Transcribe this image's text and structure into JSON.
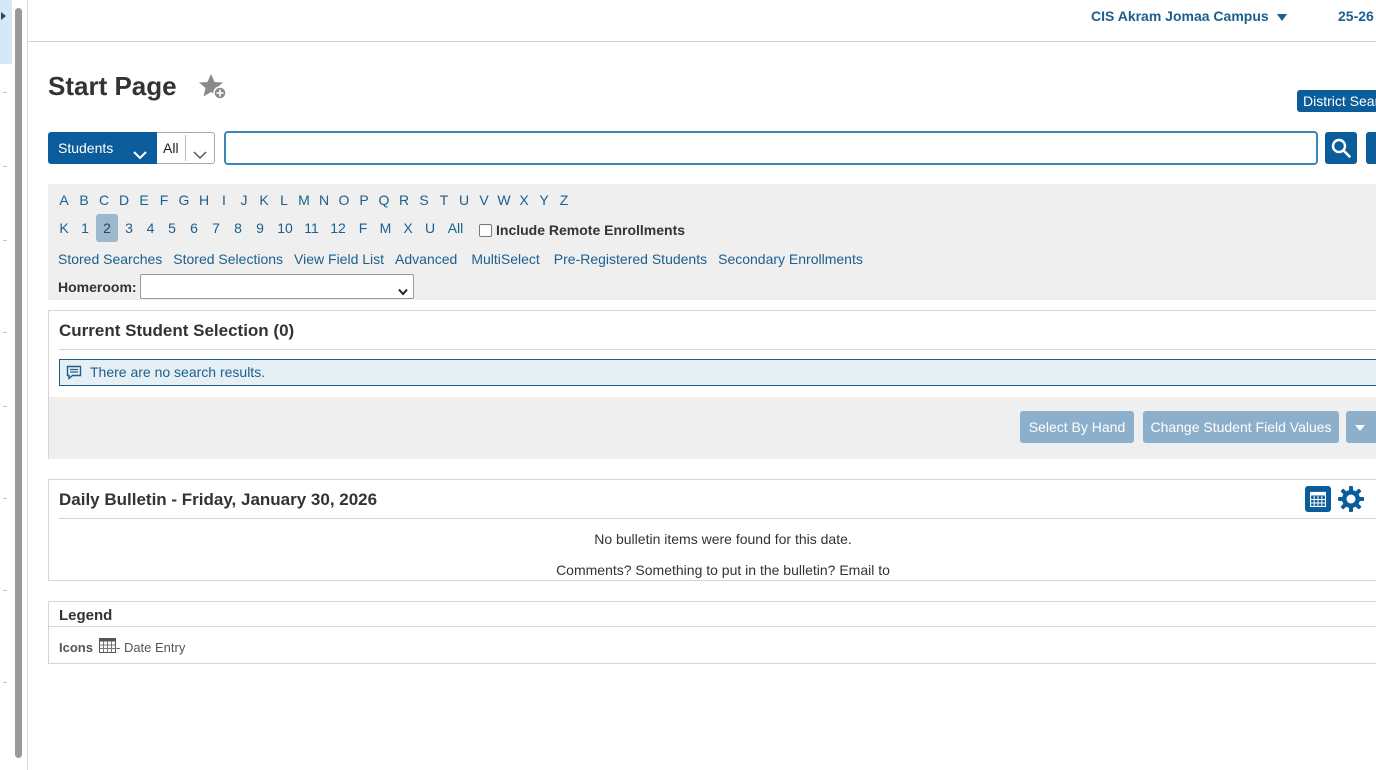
{
  "header": {
    "campus": "CIS Akram Jomaa Campus",
    "term": "25-26"
  },
  "page": {
    "title": "Start Page"
  },
  "district_search": {
    "label": "District Search"
  },
  "search": {
    "type_label": "Students",
    "filter_label": "All",
    "value": "",
    "placeholder": ""
  },
  "filters": {
    "letters": [
      "A",
      "B",
      "C",
      "D",
      "E",
      "F",
      "G",
      "H",
      "I",
      "J",
      "K",
      "L",
      "M",
      "N",
      "O",
      "P",
      "Q",
      "R",
      "S",
      "T",
      "U",
      "V",
      "W",
      "X",
      "Y",
      "Z"
    ],
    "grades": [
      "K",
      "1",
      "2",
      "3",
      "4",
      "5",
      "6",
      "7",
      "8",
      "9",
      "10",
      "11",
      "12",
      "F",
      "M",
      "X",
      "U",
      "All"
    ],
    "active_grade": "2",
    "include_remote_label": "Include Remote Enrollments",
    "links": [
      "Stored Searches",
      "Stored Selections",
      "View Field List",
      "Advanced",
      "MultiSelect",
      "Pre-Registered Students",
      "Secondary Enrollments"
    ],
    "homeroom_label": "Homeroom:",
    "homeroom_value": ""
  },
  "selection": {
    "title": "Current Student Selection (0)",
    "no_results": "There are no search results.",
    "select_by_hand": "Select By Hand",
    "change_values": "Change Student Field Values"
  },
  "bulletin": {
    "title": "Daily Bulletin - Friday, January 30, 2026",
    "empty": "No bulletin items were found for this date.",
    "comments": "Comments? Something to put in the bulletin? Email to"
  },
  "legend": {
    "title": "Legend",
    "icons_label": "Icons",
    "date_entry": "- Date Entry"
  },
  "colors": {
    "primary": "#0a5c9a",
    "link": "#1a5f8f",
    "disabled_button": "#8cb0cc",
    "panel_bg": "#efefef"
  }
}
